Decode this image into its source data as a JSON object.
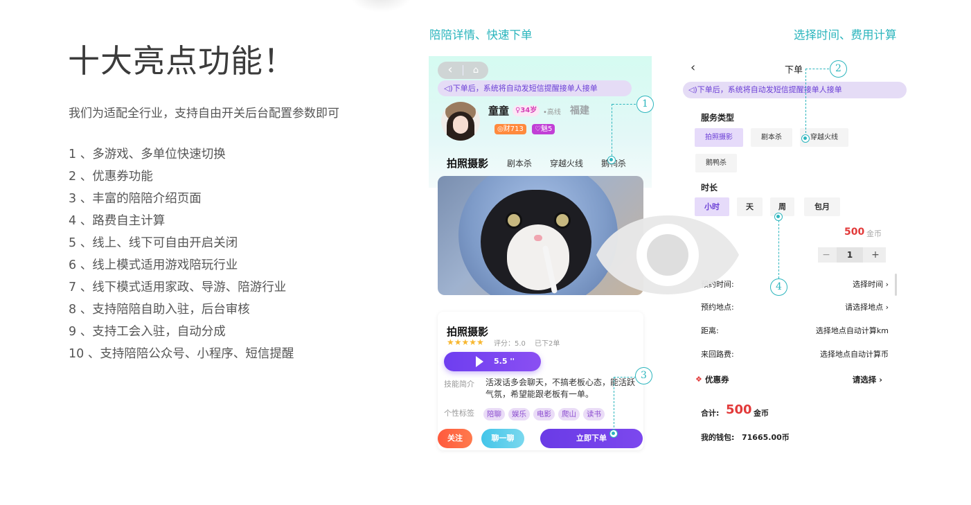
{
  "headline": "十大亮点功能！",
  "subtitle": "我们为适配全行业，支持自由开关后台配置参数即可",
  "features": [
    "1 、多游戏、多单位快速切换",
    "2 、优惠券功能",
    "3 、丰富的陪陪介绍页面",
    "4 、路费自主计算",
    "5 、线上、线下可自由开启关闭",
    "6 、线上模式适用游戏陪玩行业",
    "7 、线下模式适用家政、导游、陪游行业",
    "8 、支持陪陪自助入驻，后台审核",
    "9 、支持工会入驻，自动分成",
    "10 、支持陪陪公众号、小程序、短信提醒"
  ],
  "captions": {
    "left": "陪陪详情、快速下单",
    "right": "选择时间、费用计算"
  },
  "screen1": {
    "back_glyph": "‹",
    "home_glyph": "⌂",
    "notice": "◁)下单后，系统将自动发短信提醒接单人接单",
    "profile": {
      "name": "童童",
      "age": "♀34岁",
      "level": "•高线",
      "city": "福建",
      "wealth": "◎财713",
      "charm": "♡魅5"
    },
    "tabs": [
      "拍照摄影",
      "剧本杀",
      "穿越火线",
      "鹅鸭杀"
    ],
    "card": {
      "title": "拍照摄影",
      "stars": "★★★★★",
      "rating": "评分：5.0",
      "orders": "已下2单",
      "voice_duration": "5.5 ''",
      "intro_label": "技能简介",
      "intro_text": "活泼话多会聊天，不搞老板心态，能活跃气氛，希望能跟老板有一单。",
      "tags_label": "个性标签",
      "tags": [
        "陪聊",
        "娱乐",
        "电影",
        "爬山",
        "读书"
      ]
    },
    "buttons": {
      "follow": "关注",
      "chat": "聊一聊",
      "order": "立即下单"
    }
  },
  "screen2": {
    "back_glyph": "‹",
    "title": "下单",
    "notice": "◁)下单后，系统将自动发短信提醒接单人接单",
    "service_type_label": "服务类型",
    "service_types": [
      "拍照摄影",
      "剧本杀",
      "穿越火线",
      "鹅鸭杀"
    ],
    "duration_label": "时长",
    "durations": [
      "小时",
      "天",
      "周",
      "包月"
    ],
    "price": "500",
    "price_unit": "金币",
    "quantity": "1",
    "minus": "−",
    "plus": "+",
    "rows": [
      {
        "label": "预约时间:",
        "value": "选择时间 ›"
      },
      {
        "label": "预约地点:",
        "value": "请选择地点 ›"
      },
      {
        "label": "距离:",
        "value": "选择地点自动计算km"
      },
      {
        "label": "来回路费:",
        "value": "选择地点自动计算币"
      }
    ],
    "coupon_icon": "❖",
    "coupon_label": "优惠券",
    "coupon_value": "请选择 ›",
    "total_label": "合计:",
    "total_value": "500",
    "total_unit": "金币",
    "wallet_label": "我的钱包:",
    "wallet_value": "71665.00币"
  },
  "callouts": [
    "1",
    "2",
    "3",
    "4"
  ],
  "colors": {
    "accent": "#2bb5bd",
    "purple": "#6b3fd6",
    "price_red": "#e23a3a"
  },
  "icons": {
    "overlay": "eye-icon"
  }
}
